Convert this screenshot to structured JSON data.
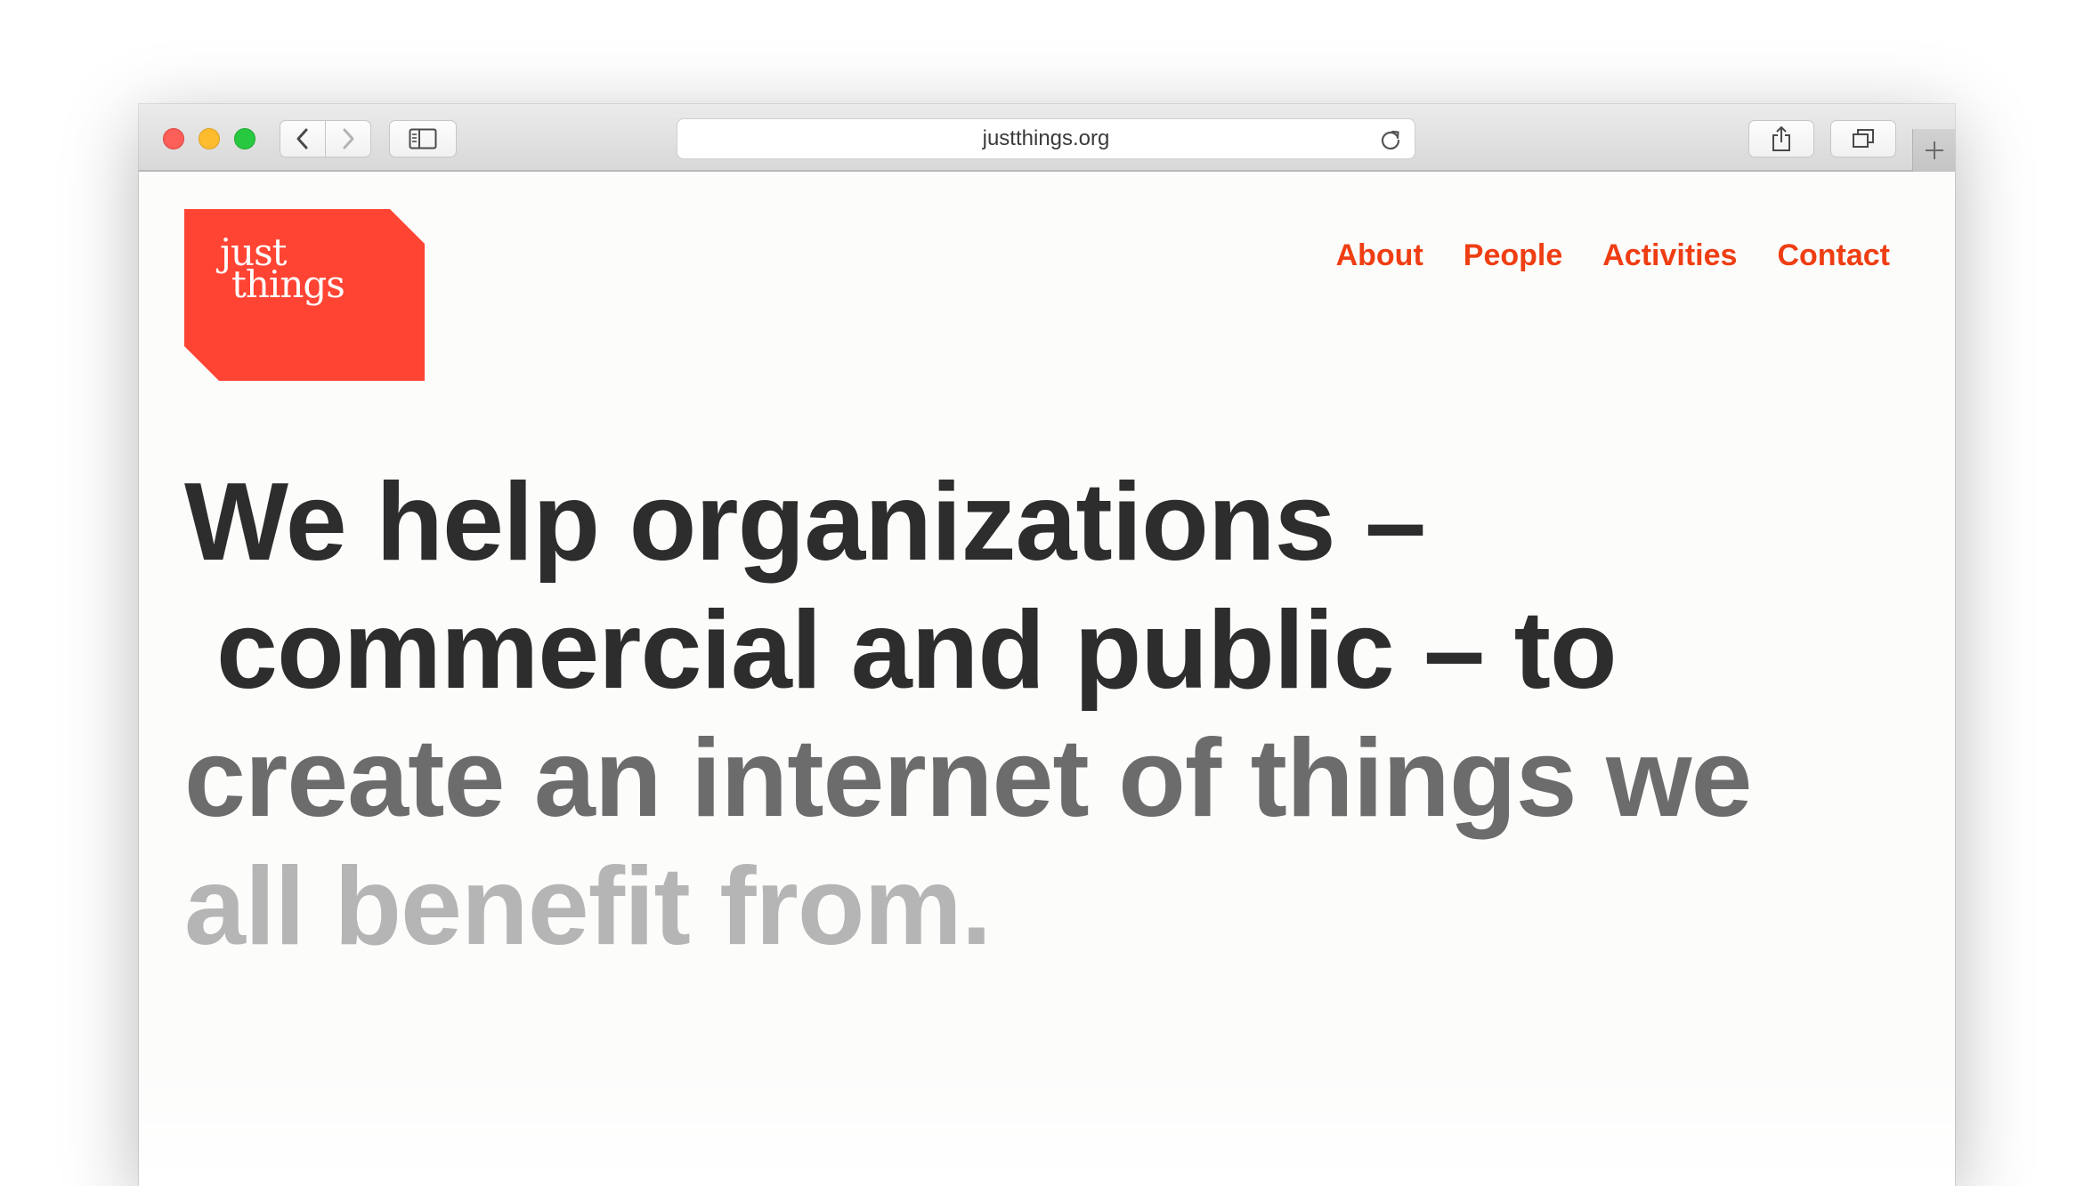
{
  "browser": {
    "url": "justthings.org",
    "icons": {
      "back": "chevron-left-icon",
      "forward": "chevron-right-icon",
      "sidebar": "sidebar-icon",
      "reload": "reload-icon",
      "share": "share-icon",
      "tabs": "tabs-overview-icon",
      "new_tab": "plus-icon"
    }
  },
  "site": {
    "logo": {
      "line1": "just",
      "line2": "things",
      "color": "#ff4433"
    },
    "nav": [
      "About",
      "People",
      "Activities",
      "Contact"
    ],
    "nav_color": "#ef3e13",
    "hero": {
      "lines": [
        "We help organizations –",
        "commercial and public – to",
        "create an internet of things we",
        "all benefit from."
      ]
    }
  }
}
